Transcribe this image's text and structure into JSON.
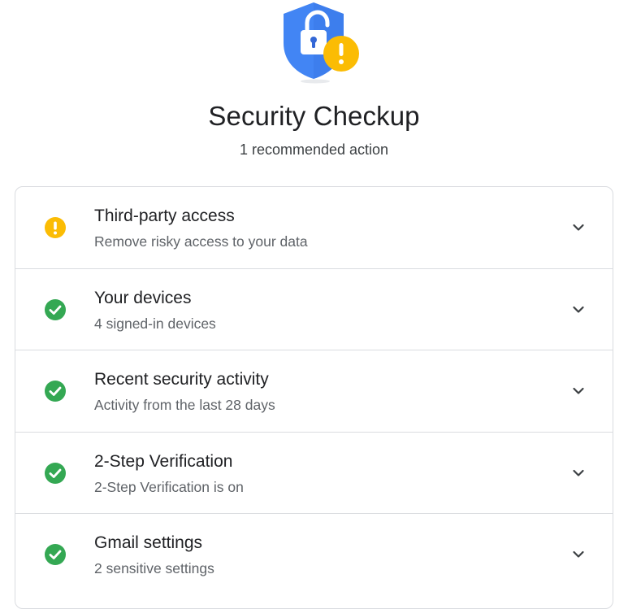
{
  "header": {
    "title": "Security Checkup",
    "subtitle": "1 recommended action",
    "illustration_icon": "shield-unlocked-warning-icon"
  },
  "colors": {
    "shield_blue": "#4285f4",
    "shield_dark_blue": "#3367d6",
    "warning_yellow": "#fbbc04",
    "success_green": "#34a853",
    "divider": "#dadce0",
    "title_text": "#202124",
    "secondary_text": "#5f6368"
  },
  "items": [
    {
      "title": "Third-party access",
      "subtitle": "Remove risky access to your data",
      "status": "warning",
      "status_icon": "warning-icon",
      "expand_icon": "chevron-down-icon"
    },
    {
      "title": "Your devices",
      "subtitle": "4 signed-in devices",
      "status": "ok",
      "status_icon": "check-circle-icon",
      "expand_icon": "chevron-down-icon"
    },
    {
      "title": "Recent security activity",
      "subtitle": "Activity from the last 28 days",
      "status": "ok",
      "status_icon": "check-circle-icon",
      "expand_icon": "chevron-down-icon"
    },
    {
      "title": "2-Step Verification",
      "subtitle": "2-Step Verification is on",
      "status": "ok",
      "status_icon": "check-circle-icon",
      "expand_icon": "chevron-down-icon"
    },
    {
      "title": "Gmail settings",
      "subtitle": "2 sensitive settings",
      "status": "ok",
      "status_icon": "check-circle-icon",
      "expand_icon": "chevron-down-icon"
    }
  ]
}
